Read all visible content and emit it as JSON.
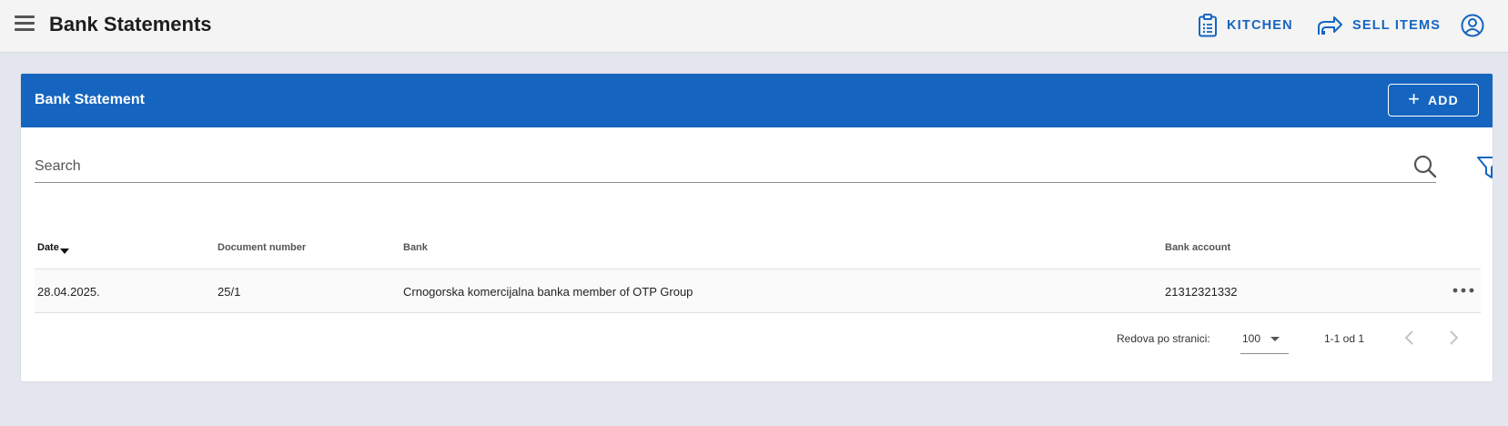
{
  "header": {
    "title": "Bank Statements",
    "nav": [
      {
        "label": "KITCHEN",
        "icon": "clipboard-icon"
      },
      {
        "label": "SELL ITEMS",
        "icon": "share-arrow-icon"
      }
    ],
    "account_icon": "account-circle-icon"
  },
  "card": {
    "title": "Bank Statement",
    "add_label": "ADD"
  },
  "search": {
    "placeholder": "Search",
    "value": ""
  },
  "table": {
    "columns": [
      "Date",
      "Document number",
      "Bank",
      "Bank account"
    ],
    "sort_column": "Date",
    "sort_direction": "descending",
    "rows": [
      [
        "28.04.2025.",
        "25/1",
        "Crnogorska komercijalna banka member of OTP Group",
        "21312321332"
      ]
    ]
  },
  "pagination": {
    "rows_label": "Redova po stranici:",
    "rows_per_page": "100",
    "range": "1-1 od 1"
  },
  "colors": {
    "accent": "#1565c0",
    "background": "#e3e6ef",
    "topbar": "#f4f4f4"
  }
}
